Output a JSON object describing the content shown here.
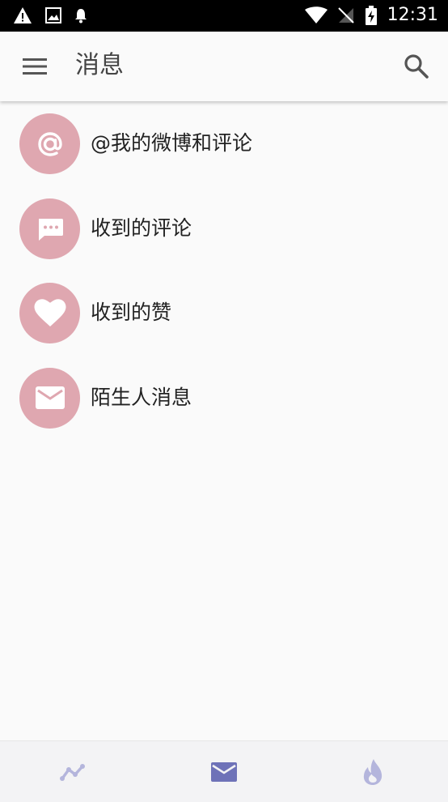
{
  "status_bar": {
    "time": "12:31",
    "icons_left": [
      "warning-icon",
      "image-icon",
      "bell-icon"
    ],
    "icons_right": [
      "wifi-icon",
      "no-signal-icon",
      "battery-charging-icon"
    ]
  },
  "app_bar": {
    "title": "消息",
    "menu_icon": "hamburger-menu-icon",
    "search_icon": "search-icon"
  },
  "colors": {
    "avatar_bg": "#dfa7b0",
    "nav_active": "#6e72b8",
    "nav_inactive": "#b4b5dc"
  },
  "list": {
    "items": [
      {
        "label": "@我的微博和评论",
        "icon": "at-sign-icon"
      },
      {
        "label": "收到的评论",
        "icon": "comment-icon"
      },
      {
        "label": "收到的赞",
        "icon": "heart-icon"
      },
      {
        "label": "陌生人消息",
        "icon": "mail-icon"
      }
    ]
  },
  "bottom_nav": {
    "items": [
      {
        "icon": "trend-icon",
        "active": false
      },
      {
        "icon": "mail-icon",
        "active": true
      },
      {
        "icon": "fire-icon",
        "active": false
      }
    ]
  }
}
